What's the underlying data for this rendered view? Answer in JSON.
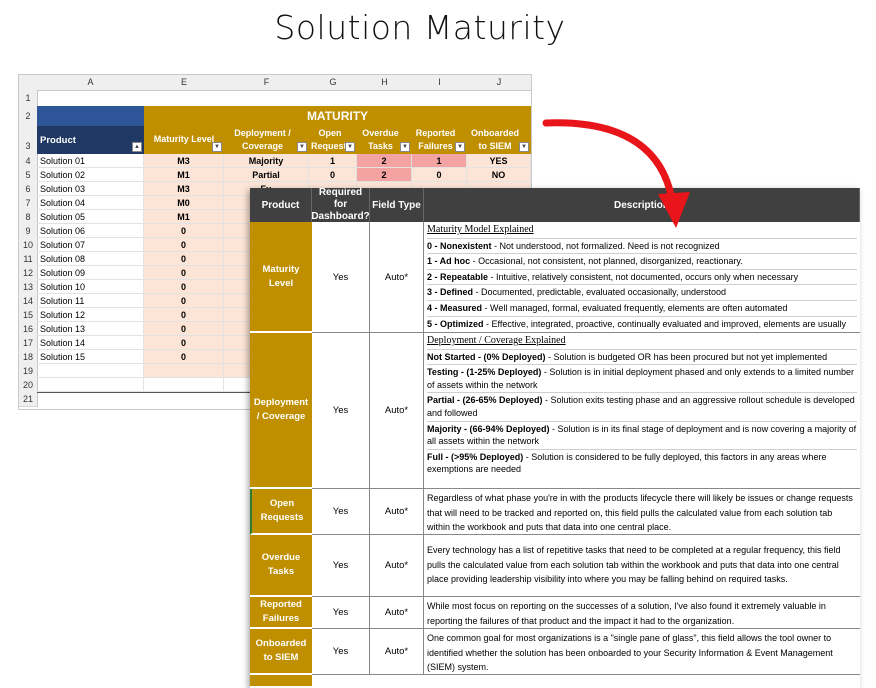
{
  "page_title": "Solution Maturity",
  "spreadsheet": {
    "columns": [
      "A",
      "E",
      "F",
      "G",
      "H",
      "I",
      "J"
    ],
    "row_numbers": [
      "1",
      "2",
      "3",
      "4",
      "5",
      "6",
      "7",
      "8",
      "9",
      "10",
      "11",
      "12",
      "13",
      "14",
      "15",
      "16",
      "17",
      "18",
      "19",
      "20",
      "21"
    ],
    "group_header": "MATURITY",
    "headers": {
      "product": "Product",
      "maturity_level": "Maturity Level",
      "deployment": "Deployment / Coverage",
      "open_requests": "Open Requests",
      "overdue_tasks": "Overdue Tasks",
      "reported_failures": "Reported Failures",
      "onboarded": "Onboarded to SIEM"
    },
    "rows": [
      {
        "product": "Solution 01",
        "level": "M3",
        "deploy": "Majority",
        "open": "1",
        "overdue": "2",
        "failures": "1",
        "siem": "YES"
      },
      {
        "product": "Solution 02",
        "level": "M1",
        "deploy": "Partial",
        "open": "0",
        "overdue": "2",
        "failures": "0",
        "siem": "NO"
      },
      {
        "product": "Solution 03",
        "level": "M3",
        "deploy": "Fu",
        "open": "",
        "overdue": "",
        "failures": "",
        "siem": ""
      },
      {
        "product": "Solution 04",
        "level": "M0",
        "deploy": "Not St",
        "open": "",
        "overdue": "",
        "failures": "",
        "siem": ""
      },
      {
        "product": "Solution 05",
        "level": "M1",
        "deploy": "Majo",
        "open": "",
        "overdue": "",
        "failures": "",
        "siem": ""
      },
      {
        "product": "Solution 06",
        "level": "0",
        "deploy": "Not St",
        "open": "",
        "overdue": "",
        "failures": "",
        "siem": ""
      },
      {
        "product": "Solution 07",
        "level": "0",
        "deploy": "Not St",
        "open": "",
        "overdue": "",
        "failures": "",
        "siem": ""
      },
      {
        "product": "Solution 08",
        "level": "0",
        "deploy": "Not St",
        "open": "",
        "overdue": "",
        "failures": "",
        "siem": ""
      },
      {
        "product": "Solution 09",
        "level": "0",
        "deploy": "Not St",
        "open": "",
        "overdue": "",
        "failures": "",
        "siem": ""
      },
      {
        "product": "Solution 10",
        "level": "0",
        "deploy": "Not St",
        "open": "",
        "overdue": "",
        "failures": "",
        "siem": ""
      },
      {
        "product": "Solution 11",
        "level": "0",
        "deploy": "Not St",
        "open": "",
        "overdue": "",
        "failures": "",
        "siem": ""
      },
      {
        "product": "Solution 12",
        "level": "0",
        "deploy": "Not St",
        "open": "",
        "overdue": "",
        "failures": "",
        "siem": ""
      },
      {
        "product": "Solution 13",
        "level": "0",
        "deploy": "Not St",
        "open": "",
        "overdue": "",
        "failures": "",
        "siem": ""
      },
      {
        "product": "Solution 14",
        "level": "0",
        "deploy": "Not St",
        "open": "",
        "overdue": "",
        "failures": "",
        "siem": ""
      },
      {
        "product": "Solution 15",
        "level": "0",
        "deploy": "Not St",
        "open": "",
        "overdue": "",
        "failures": "",
        "siem": ""
      }
    ]
  },
  "description_table": {
    "headers": {
      "product": "Product",
      "required": "Required for Dashboard?",
      "field_type": "Field Type",
      "description": "Description"
    },
    "rows": [
      {
        "product": "Maturity Level",
        "required": "Yes",
        "field_type": "Auto*",
        "heading": "Maturity Model Explained",
        "items": [
          {
            "term": "0 - Nonexistent",
            "text": " - Not understood, not formalized. Need is not recognized"
          },
          {
            "term": "1 - Ad hoc",
            "text": " - Occasional, not consistent, not planned, disorganized, reactionary."
          },
          {
            "term": "2 - Repeatable",
            "text": " - Intuitive, relatively consistent, not documented, occurs only when necessary"
          },
          {
            "term": "3 - Defined",
            "text": " - Documented, predictable, evaluated occasionally, understood"
          },
          {
            "term": "4 - Measured",
            "text": " - Well managed, formal, evaluated frequently, elements are often automated"
          },
          {
            "term": "5 - Optimized",
            "text": " - Effective, integrated, proactive, continually evaluated and improved, elements are usually automated"
          }
        ]
      },
      {
        "product": "Deployment / Coverage",
        "required": "Yes",
        "field_type": "Auto*",
        "heading": "Deployment / Coverage Explained",
        "items": [
          {
            "term": "Not Started - (0% Deployed)",
            "text": " - Solution is budgeted OR has been procured but not yet implemented"
          },
          {
            "term": "Testing - (1-25% Deployed)",
            "text": " - Solution is in initial deployment phased and only extends to a limited number of assets within the network"
          },
          {
            "term": "Partial - (26-65% Deployed)",
            "text": " - Solution exits testing phase and an aggressive rollout schedule is developed and followed"
          },
          {
            "term": "Majority - (66-94% Deployed)",
            "text": " - Solution is in its final stage of deployment and is now covering a majority of all assets within the network"
          },
          {
            "term": "Full - (>95% Deployed)",
            "text": " - Solution is considered to be fully deployed, this factors in any areas where exemptions are needed"
          }
        ]
      },
      {
        "product": "Open Requests",
        "required": "Yes",
        "field_type": "Auto*",
        "text": "Regardless of what phase you're in with the products lifecycle there will likely be issues or change requests that will need to be tracked and reported on, this field pulls the calculated value from each solution tab within the workbook and puts that data into one central place."
      },
      {
        "product": "Overdue Tasks",
        "required": "Yes",
        "field_type": "Auto*",
        "text": "Every technology has a list of repetitive tasks that need to be completed at a regular frequency, this field pulls the calculated value from each solution tab within the workbook and puts that data into one central place providing leadership visibility into where you may be falling behind on required tasks."
      },
      {
        "product": "Reported Failures",
        "required": "Yes",
        "field_type": "Auto*",
        "text": "While most focus on reporting on the successes of a solution, I've also found it extremely valuable in reporting the failures of that product and the impact it had to the organization."
      },
      {
        "product": "Onboarded to SIEM",
        "required": "Yes",
        "field_type": "Auto*",
        "text": "One common goal for most organizations is a \"single pane of glass\", this field allows the tool owner to identified whether the solution has been onboarded to your Security Information & Event Management (SIEM) system."
      }
    ]
  },
  "colors": {
    "gold": "#bf8f00",
    "navy": "#1f3864",
    "pink": "#fce4d6",
    "red_highlight": "#f4a3a3",
    "arrow": "#e8151b",
    "header_dark": "#404040"
  }
}
